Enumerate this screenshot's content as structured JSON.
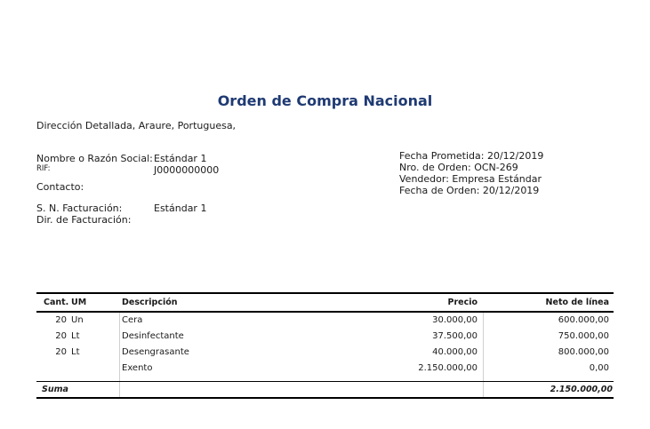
{
  "title": "Orden de Compra Nacional",
  "address": "Dirección Detallada, Araure, Portuguesa,",
  "client": {
    "name_label": "Nombre o Razón Social:",
    "name_value": "Estándar 1",
    "rif_label": "RIF:",
    "rif_value": "J0000000000",
    "contact_label": "Contacto:",
    "billing_label": "S. N. Facturación:",
    "billing_value": "Estándar 1",
    "billing_dir_label": "Dir. de Facturación:"
  },
  "order_info": {
    "promised_date": "Fecha Prometida: 20/12/2019",
    "order_number": "Nro. de Orden:  OCN-269",
    "vendor": "Vendedor: Empresa Estándar",
    "order_date": "Fecha de Orden: 20/12/2019"
  },
  "table": {
    "headers": {
      "qty": "Cant.",
      "um": "UM",
      "description": "Descripción",
      "price": "Precio",
      "net": "Neto de línea"
    },
    "rows": [
      {
        "qty": "20",
        "um": "Un",
        "description": "Cera",
        "price": "30.000,00",
        "net": "600.000,00"
      },
      {
        "qty": "20",
        "um": "Lt",
        "description": "Desinfectante",
        "price": "37.500,00",
        "net": "750.000,00"
      },
      {
        "qty": "20",
        "um": "Lt",
        "description": "Desengrasante",
        "price": "40.000,00",
        "net": "800.000,00"
      },
      {
        "qty": "",
        "um": "",
        "description": "Exento",
        "price": "2.150.000,00",
        "net": "0,00"
      }
    ],
    "total_label": "Suma",
    "total_value": "2.150.000,00"
  }
}
